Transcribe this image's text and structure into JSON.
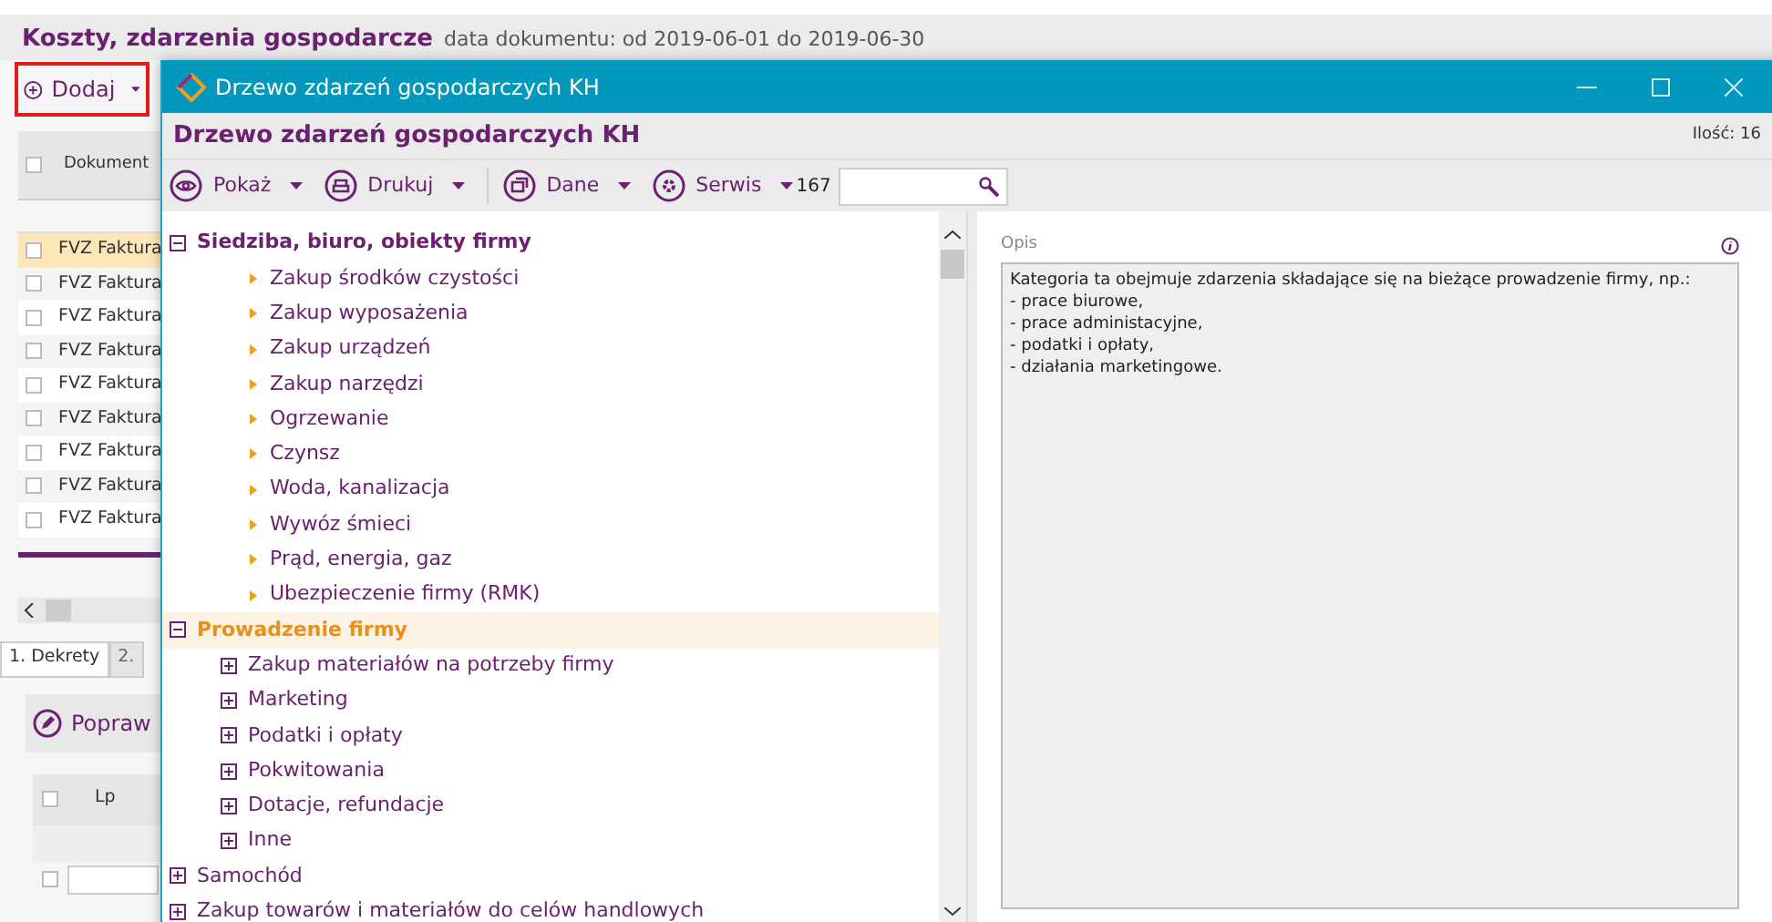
{
  "app": {
    "title": "Koszty, zdarzenia gospodarcze",
    "subtitle": "data dokumentu: od 2019-06-01 do 2019-06-30",
    "add_button": "Dodaj",
    "grid": {
      "column": "Dokument",
      "all_checked": false,
      "rows": [
        {
          "text": "FVZ Faktura",
          "selected": true
        },
        {
          "text": "FVZ Faktura",
          "selected": false
        },
        {
          "text": "FVZ Faktura",
          "selected": false
        },
        {
          "text": "FVZ Faktura",
          "selected": false
        },
        {
          "text": "FVZ Faktura",
          "selected": false
        },
        {
          "text": "FVZ Faktura",
          "selected": false
        },
        {
          "text": "FVZ Faktura",
          "selected": false
        },
        {
          "text": "FVZ Faktura",
          "selected": false
        },
        {
          "text": "FVZ Faktura",
          "selected": false
        }
      ]
    },
    "tabs": [
      {
        "label": "1. Dekrety",
        "selected": true
      },
      {
        "label": "2.",
        "selected": false
      }
    ],
    "edit_button": "Popraw",
    "lines_column": "Lp",
    "lines_all_checked": false,
    "line_checked": false
  },
  "dialog": {
    "title": "Drzewo zdarzeń gospodarczych KH",
    "header": "Drzewo zdarzeń gospodarczych KH",
    "count": "Ilość: 16",
    "toolbar": [
      {
        "label": "Pokaż",
        "kind": "eye"
      },
      {
        "label": "Drukuj",
        "kind": "print"
      },
      {
        "label": "Dane",
        "kind": "data"
      },
      {
        "label": "Serwis",
        "kind": "gear"
      }
    ],
    "search_count": "167",
    "tree": [
      {
        "label": "Siedziba, biuro, obiekty firmy",
        "kind": "group",
        "expanded": true,
        "selected": false,
        "children": [
          {
            "label": "Zakup środków czystości",
            "kind": "leaf",
            "selected": false
          },
          {
            "label": "Zakup wyposażenia",
            "kind": "leaf",
            "selected": false
          },
          {
            "label": "Zakup urządzeń",
            "kind": "leaf",
            "selected": false
          },
          {
            "label": "Zakup narzędzi",
            "kind": "leaf",
            "selected": false
          },
          {
            "label": "Ogrzewanie",
            "kind": "leaf",
            "selected": false
          },
          {
            "label": "Czynsz",
            "kind": "leaf",
            "selected": false
          },
          {
            "label": "Woda, kanalizacja",
            "kind": "leaf",
            "selected": false
          },
          {
            "label": "Wywóz śmieci",
            "kind": "leaf",
            "selected": false
          },
          {
            "label": "Prąd, energia, gaz",
            "kind": "leaf",
            "selected": false
          },
          {
            "label": "Ubezpieczenie firmy (RMK)",
            "kind": "leaf",
            "selected": false
          }
        ]
      },
      {
        "label": "Prowadzenie firmy",
        "kind": "group",
        "expanded": true,
        "selected": true,
        "children": [
          {
            "label": "Zakup materiałów na potrzeby firmy",
            "kind": "group",
            "expanded": false,
            "selected": false
          },
          {
            "label": "Marketing",
            "kind": "group",
            "expanded": false,
            "selected": false
          },
          {
            "label": "Podatki i opłaty",
            "kind": "group",
            "expanded": false,
            "selected": false
          },
          {
            "label": "Pokwitowania",
            "kind": "group",
            "expanded": false,
            "selected": false
          },
          {
            "label": "Dotacje, refundacje",
            "kind": "group",
            "expanded": false,
            "selected": false
          },
          {
            "label": "Inne",
            "kind": "group",
            "expanded": false,
            "selected": false
          }
        ]
      },
      {
        "label": "Samochód",
        "kind": "group",
        "expanded": false,
        "selected": false
      },
      {
        "label": "Zakup towarów i materiałów do celów handlowych",
        "kind": "group",
        "expanded": false,
        "selected": false
      }
    ],
    "description_label": "Opis",
    "description": "Kategoria ta obejmuje zdarzenia składające się na bieżące prowadzenie firmy, np.:\n- prace biurowe,\n- prace administacyjne,\n- podatki i opłaty,\n- działania marketingowe."
  }
}
